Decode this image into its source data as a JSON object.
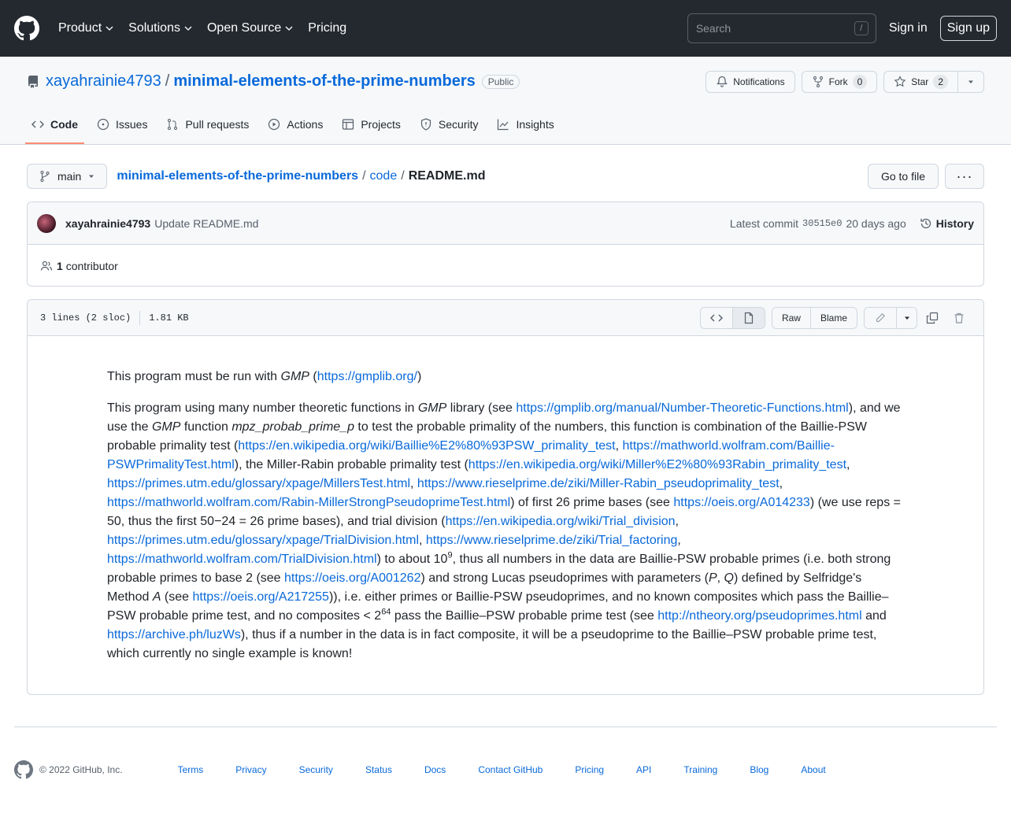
{
  "header": {
    "nav": [
      "Product",
      "Solutions",
      "Open Source",
      "Pricing"
    ],
    "search_placeholder": "Search",
    "search_shortcut": "/",
    "sign_in": "Sign in",
    "sign_up": "Sign up"
  },
  "repo": {
    "owner": "xayahrainie4793",
    "name": "minimal-elements-of-the-prime-numbers",
    "visibility": "Public",
    "notifications_label": "Notifications",
    "fork_label": "Fork",
    "fork_count": "0",
    "star_label": "Star",
    "star_count": "2",
    "tabs": [
      "Code",
      "Issues",
      "Pull requests",
      "Actions",
      "Projects",
      "Security",
      "Insights"
    ]
  },
  "file_nav": {
    "branch": "main",
    "path_repo": "minimal-elements-of-the-prime-numbers",
    "path_dir": "code",
    "path_file": "README.md",
    "goto_file": "Go to file",
    "more": "···"
  },
  "commit": {
    "author": "xayahrainie4793",
    "message": "Update README.md",
    "latest_label": "Latest commit",
    "sha": "30515e0",
    "age": "20 days ago",
    "history": "History",
    "contributors_count": "1",
    "contributors_label": "contributor"
  },
  "file": {
    "lines": "3 lines (2 sloc)",
    "size": "1.81 KB",
    "raw": "Raw",
    "blame": "Blame"
  },
  "readme": {
    "p1_a": "This program must be run with ",
    "p1_gmp": "GMP",
    "p1_b": " (",
    "p1_link": "https://gmplib.org/",
    "p1_c": ")",
    "t1": "This program using many number theoretic functions in ",
    "gmp": "GMP",
    "t2": " library (see ",
    "l1": "https://gmplib.org/manual/Number-Theoretic-Functions.html",
    "t3": "), and we use the ",
    "t4": " function ",
    "func": "mpz_probab_prime_p",
    "t5": " to test the probable primality of the numbers, this function is combination of the Baillie-PSW probable primality test (",
    "l2": "https://en.wikipedia.org/wiki/Baillie%E2%80%93PSW_primality_test",
    "comma": ", ",
    "l3": "https://mathworld.wolfram.com/Baillie-PSWPrimalityTest.html",
    "t6": "), the Miller-Rabin probable primality test (",
    "l4": "https://en.wikipedia.org/wiki/Miller%E2%80%93Rabin_primality_test",
    "l5": "https://primes.utm.edu/glossary/xpage/MillersTest.html",
    "l6": "https://www.rieselprime.de/ziki/Miller-Rabin_pseudoprimality_test",
    "l7": "https://mathworld.wolfram.com/Rabin-MillerStrongPseudoprimeTest.html",
    "t7": ") of first 26 prime bases (see ",
    "l8": "https://oeis.org/A014233",
    "t8": ") (we use reps = 50, thus the first 50−24 = 26 prime bases), and trial division (",
    "l9": "https://en.wikipedia.org/wiki/Trial_division",
    "l10": "https://primes.utm.edu/glossary/xpage/TrialDivision.html",
    "l11": "https://www.rieselprime.de/ziki/Trial_factoring",
    "l12": "https://mathworld.wolfram.com/TrialDivision.html",
    "t9": ") to about 10",
    "sup9": "9",
    "t10": ", thus all numbers in the data are Baillie-PSW probable primes (i.e. both strong probable primes to base 2 (see ",
    "l13": "https://oeis.org/A001262",
    "t11": ") and strong Lucas pseudoprimes with parameters (",
    "P": "P",
    "Q": "Q",
    "t12": ") defined by Selfridge's Method ",
    "A": "A",
    "t13": " (see ",
    "l14": "https://oeis.org/A217255",
    "t14": ")), i.e. either primes or Baillie-PSW pseudoprimes, and no known composites which pass the Baillie–PSW probable prime test, and no composites < 2",
    "sup64": "64",
    "t15": " pass the Baillie–PSW probable prime test (see ",
    "l15": "http://ntheory.org/pseudoprimes.html",
    "and": " and ",
    "l16": "https://archive.ph/luzWs",
    "t16": "), thus if a number in the data is in fact composite, it will be a pseudoprime to the Baillie–PSW probable prime test, which currently no single example is known!"
  },
  "footer": {
    "copyright": "© 2022 GitHub, Inc.",
    "links": [
      "Terms",
      "Privacy",
      "Security",
      "Status",
      "Docs",
      "Contact GitHub",
      "Pricing",
      "API",
      "Training",
      "Blog",
      "About"
    ]
  }
}
